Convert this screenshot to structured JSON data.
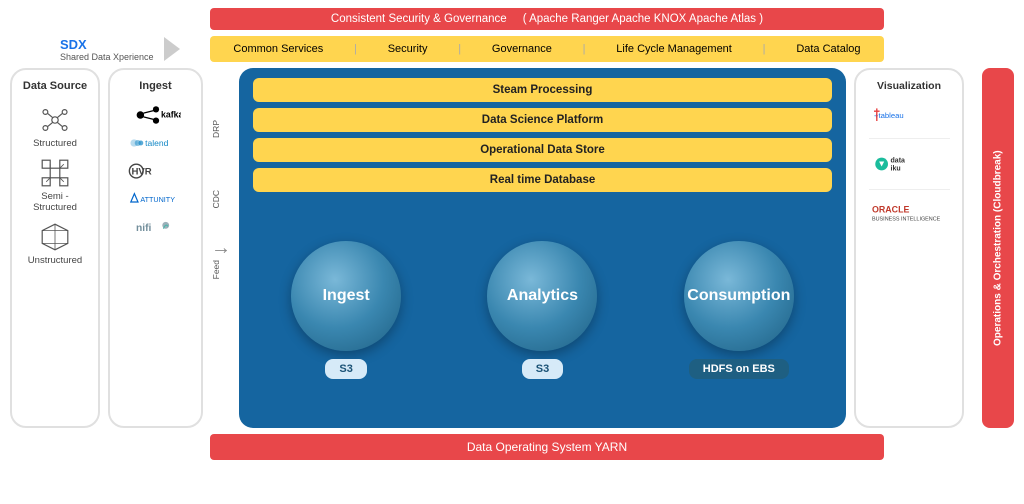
{
  "top_bar": {
    "text": "Consistent Security & Governance",
    "sub_items": "( Apache Ranger    Apache KNOX    Apache Atlas )"
  },
  "sdx": {
    "title": "SDX",
    "subtitle": "Shared Data Xperience",
    "services": [
      "Common Services",
      "Security",
      "Governance",
      "Life Cycle Management",
      "Data Catalog"
    ]
  },
  "data_source": {
    "title": "Data Source",
    "items": [
      "Structured",
      "Semi - Structured",
      "Unstructured"
    ]
  },
  "ingest": {
    "title": "Ingest",
    "items": [
      "kafka",
      "talend",
      "HVR",
      "ATTUNITY",
      "nifi"
    ]
  },
  "arrow_labels": [
    "DRP",
    "CDC",
    "Feed"
  ],
  "center_panel": {
    "yellow_bars": [
      "Steam Processing",
      "Data Science Platform",
      "Operational Data Store",
      "Real time Database"
    ],
    "circles": [
      {
        "label": "Ingest",
        "badge": "S3",
        "badge_dark": false
      },
      {
        "label": "Analytics",
        "badge": "S3",
        "badge_dark": false
      },
      {
        "label": "Consumption",
        "badge": "HDFS on EBS",
        "badge_dark": true
      }
    ]
  },
  "visualization": {
    "title": "Visualization",
    "items": [
      "+ tableau",
      "data iku",
      "ORACLE BUSINESS INTELLIGENCE"
    ]
  },
  "ops_bar": "Operations & Orchestration (Cloudbreak)",
  "bottom_bar": "Data Operating System YARN"
}
